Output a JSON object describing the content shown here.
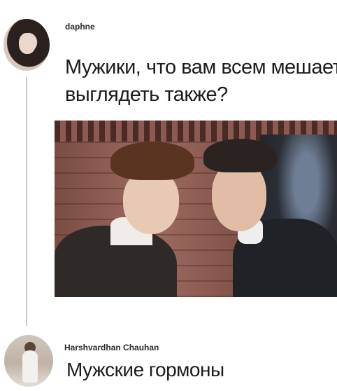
{
  "thread": {
    "post": {
      "username": "daphne",
      "text_line_1": "Мужики, что вам всем мешает",
      "text_line_2": "выглядеть также?",
      "avatar_icon": "profile-avatar-icon",
      "image_icon": "attached-photo-image"
    },
    "reply": {
      "username": "Harshvardhan Chauhan",
      "text": "Мужские гормоны",
      "avatar_icon": "profile-avatar-icon"
    }
  },
  "colors": {
    "background": "#ffffff",
    "text": "#1c1c1c",
    "thread_line": "#c9c9c9"
  }
}
